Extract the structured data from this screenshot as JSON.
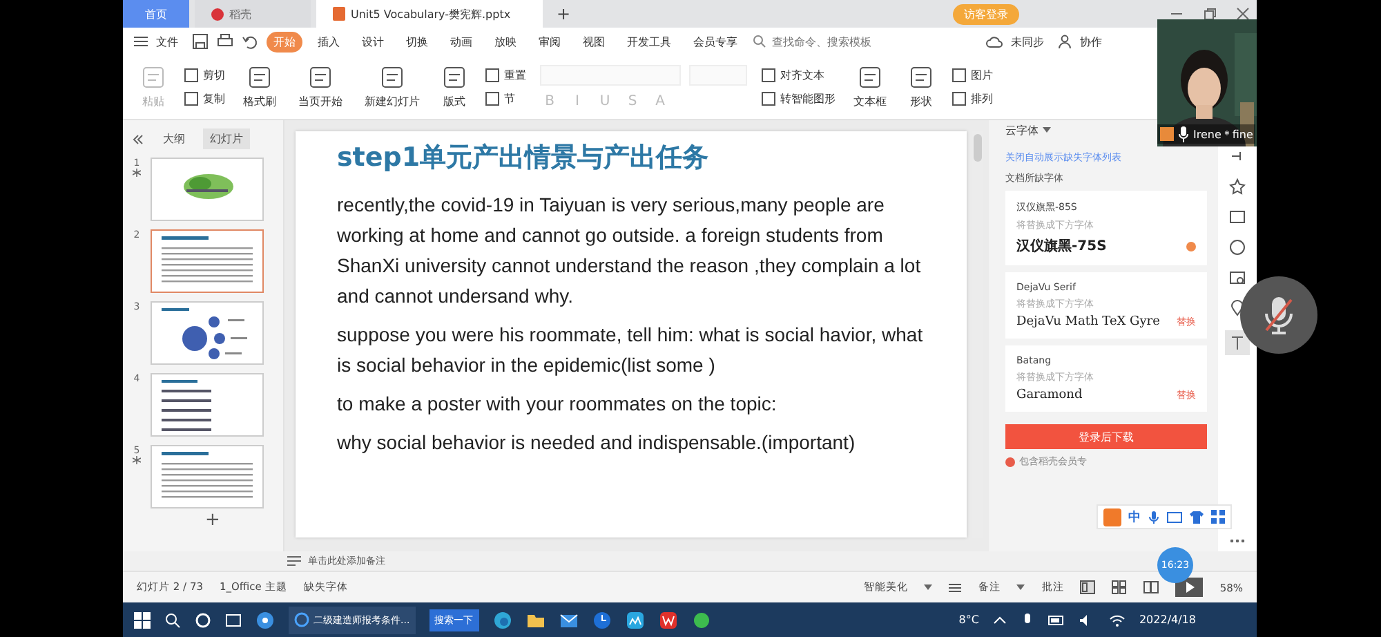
{
  "titlebar": {
    "tabs": [
      {
        "label": "首页",
        "kind": "home",
        "selected": false
      },
      {
        "label": "稻壳",
        "kind": "app",
        "selected": false
      },
      {
        "label": "Unit5 Vocabulary-樊宪辉.pptx",
        "kind": "file",
        "selected": true
      }
    ],
    "add_tab": "+",
    "login": "访客登录"
  },
  "menu": {
    "file": "文件",
    "tabs": [
      {
        "label": "开始",
        "selected": true
      },
      {
        "label": "插入",
        "selected": false
      },
      {
        "label": "设计",
        "selected": false
      },
      {
        "label": "切换",
        "selected": false
      },
      {
        "label": "动画",
        "selected": false
      },
      {
        "label": "放映",
        "selected": false
      },
      {
        "label": "审阅",
        "selected": false
      },
      {
        "label": "视图",
        "selected": false
      },
      {
        "label": "开发工具",
        "selected": false
      },
      {
        "label": "会员专享",
        "selected": false
      }
    ],
    "search": {
      "placeholder": "查找命令、搜索模板"
    },
    "sync": "未同步",
    "collab": "协作"
  },
  "ribbon": [
    {
      "kind": "large",
      "label": "粘贴",
      "disabled": true
    },
    {
      "kind": "stack",
      "items": [
        "剪切",
        "复制"
      ]
    },
    {
      "kind": "large",
      "label": "格式刷",
      "disabled": false
    },
    {
      "kind": "large",
      "label": "当页开始",
      "disabled": false
    },
    {
      "kind": "large",
      "label": "新建幻灯片",
      "disabled": false
    },
    {
      "kind": "large",
      "label": "版式",
      "disabled": false
    },
    {
      "kind": "stack",
      "items": [
        "重置",
        "节"
      ]
    },
    {
      "kind": "font",
      "items": [
        "B",
        "I",
        "U",
        "S",
        "A"
      ]
    },
    {
      "kind": "stack",
      "items": [
        "对齐文本",
        "转智能图形"
      ]
    },
    {
      "kind": "large",
      "label": "文本框",
      "disabled": false
    },
    {
      "kind": "large",
      "label": "形状",
      "disabled": false
    },
    {
      "kind": "stack",
      "items": [
        "图片",
        "排列"
      ]
    }
  ],
  "outline": {
    "tabs": [
      {
        "label": "大纲",
        "selected": false
      },
      {
        "label": "幻灯片",
        "selected": true
      }
    ],
    "slides": [
      {
        "number": "1",
        "kind": "title",
        "selected": false,
        "starred": true
      },
      {
        "number": "2",
        "kind": "text",
        "selected": true,
        "starred": false
      },
      {
        "number": "3",
        "kind": "diagram",
        "selected": false,
        "starred": false
      },
      {
        "number": "4",
        "kind": "list",
        "selected": false,
        "starred": false
      },
      {
        "number": "5",
        "kind": "text",
        "selected": false,
        "starred": true
      }
    ],
    "add": "+"
  },
  "slide": {
    "title": "step1单元产出情景与产出任务",
    "paragraphs": [
      "recently,the covid-19 in Taiyuan is very serious,many people are working at home and cannot go outside. a foreign students from ShanXi university cannot understand the reason ,they complain a lot and cannot undersand why.",
      "suppose you were his roommate, tell him: what is social havior, what is social behavior in the epidemic(list some )",
      " to make a poster with your roommates on the topic:",
      "why social behavior is needed and indispensable.(important)"
    ]
  },
  "font_panel": {
    "header": "云字体",
    "close_link": "关闭自动展示缺失字体列表",
    "section": "文档所缺字体",
    "fonts": [
      {
        "missing": "汉仪旗黑-85S",
        "hint": "将替换成下方字体",
        "replacement": "汉仪旗黑-75S",
        "kind": "badge"
      },
      {
        "missing": "DejaVu Serif",
        "hint": "将替换成下方字体",
        "replacement": "DejaVu Math TeX Gyre",
        "kind": "link",
        "action": "替换"
      },
      {
        "missing": "Batang",
        "hint": "将替换成下方字体",
        "replacement": "Garamond",
        "kind": "link",
        "action": "替换"
      }
    ],
    "download": "登录后下载",
    "footer": "包含稻壳会员专"
  },
  "ime": {
    "mode": "中"
  },
  "notes": {
    "placeholder": "单击此处添加备注"
  },
  "status_bar": {
    "slide": "幻灯片 2 / 73",
    "theme": "1_Office 主题",
    "missing_fonts": "缺失字体",
    "beautify": "智能美化",
    "notes": "备注",
    "comments": "批注",
    "zoom": "58%"
  },
  "taskbar": {
    "browser_tab": "二级建造师报考条件...",
    "search": "搜索一下",
    "weather": "8°C",
    "date": "2022/4/18"
  },
  "webcam": {
    "name": "Irene＊fine"
  },
  "clock": "16:23"
}
